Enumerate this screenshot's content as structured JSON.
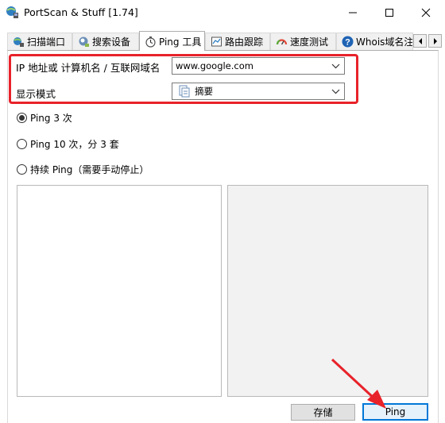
{
  "window": {
    "title": "PortScan & Stuff [1.74]"
  },
  "tabs": [
    {
      "label": "扫描端口",
      "icon": "network-globe-icon",
      "active": false
    },
    {
      "label": "搜索设备",
      "icon": "search-device-icon",
      "active": false
    },
    {
      "label": "Ping 工具",
      "icon": "stopwatch-icon",
      "active": true
    },
    {
      "label": "路由跟踪",
      "icon": "route-trace-icon",
      "active": false
    },
    {
      "label": "速度测试",
      "icon": "speed-gauge-icon",
      "active": false
    },
    {
      "label": "Whois域名注",
      "icon": "question-circle-icon",
      "active": false
    }
  ],
  "form": {
    "target_label": "IP 地址或 计算机名 / 互联网域名",
    "target_value": "www.google.com",
    "display_label": "显示模式",
    "display_value": "摘要",
    "display_icon": "document-icon"
  },
  "ping_options": [
    {
      "label": "Ping 3 次",
      "selected": true
    },
    {
      "label": "Ping 10 次，分 3 套",
      "selected": false
    },
    {
      "label": "持续 Ping（需要手动停止）",
      "selected": false
    }
  ],
  "buttons": {
    "save_label": "存储",
    "ping_label": "Ping"
  },
  "colors": {
    "highlight": "#e8222a",
    "annotation_arrow": "#e8222a",
    "ping_button_border": "#0078d7"
  }
}
